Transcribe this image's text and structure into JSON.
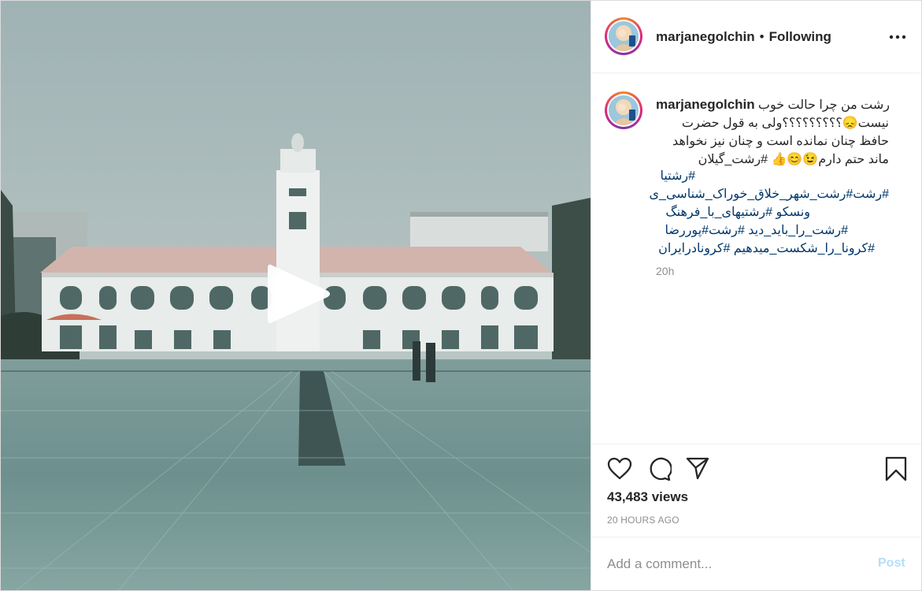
{
  "post": {
    "username": "marjanegolchin",
    "separator": "•",
    "follow_status": "Following",
    "caption": {
      "lines": [
        {
          "text": "رشت من چرا حالت خوب",
          "tags": []
        },
        {
          "text": "نیست😞؟؟؟؟؟؟؟؟؟ولی به قول حضرت",
          "tags": []
        },
        {
          "text": "حافظ چنان نمانده است و چنان نیز نخواهد",
          "tags": []
        },
        {
          "text": "ماند حتم دارم😉😊👍 #رشت_گیلان",
          "tags": []
        },
        {
          "text": "#رشتیا",
          "tags": []
        },
        {
          "text": "#رشت#رشت_شهر_خلاق_خوراک_شناسی_ی",
          "tags": []
        },
        {
          "text": "ونسکو #رشتیهای_با_فرهنگ",
          "tags": []
        },
        {
          "text": "#رشت_را_باید_دید #رشت#پوررضا",
          "tags": []
        },
        {
          "text": "#کرونا_را_شکست_میدهیم #کرونادرایران",
          "tags": []
        }
      ]
    },
    "relative_time": "20h",
    "views": "43,483 views",
    "timestamp": "20 HOURS AGO",
    "comment_placeholder": "Add a comment...",
    "post_label": "Post"
  },
  "icons": {
    "more": "more-options-icon",
    "like": "heart-icon",
    "comment": "comment-icon",
    "share": "paper-plane-icon",
    "save": "bookmark-icon",
    "play": "play-icon"
  },
  "colors": {
    "link": "#00376b",
    "muted": "#8e8e8e",
    "post_disabled": "#b2dffc",
    "border": "#dbdbdb"
  }
}
